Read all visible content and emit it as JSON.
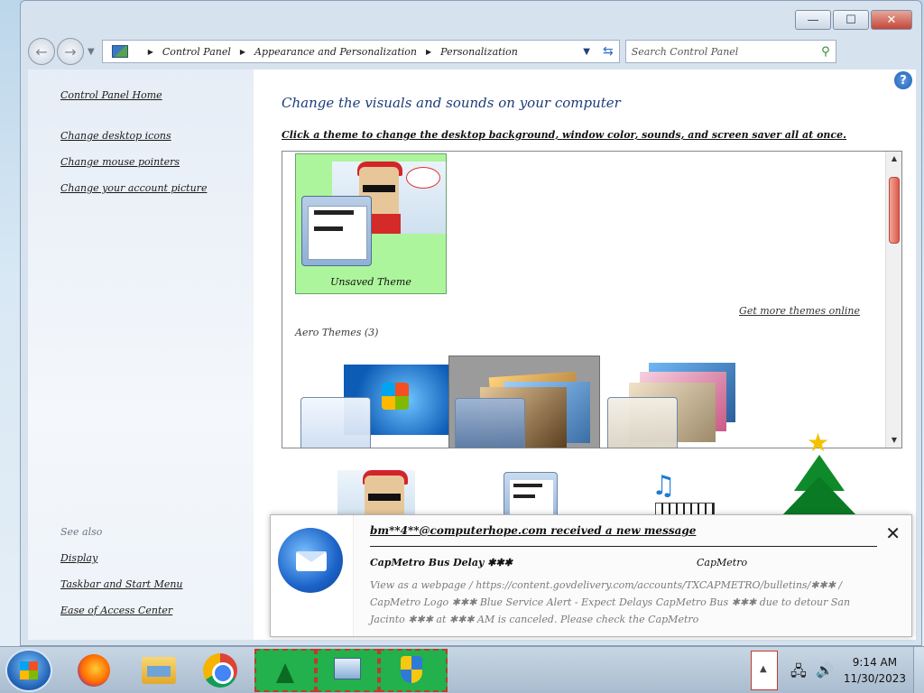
{
  "window": {
    "caption_buttons": {
      "minimize": "—",
      "maximize": "☐",
      "close": "✕"
    }
  },
  "nav": {
    "back": "←",
    "forward": "→",
    "breadcrumbs": [
      "Control Panel",
      "Appearance and Personalization",
      "Personalization"
    ],
    "search_placeholder": "Search Control Panel"
  },
  "sidebar": {
    "home": "Control Panel Home",
    "links": [
      "Change desktop icons",
      "Change mouse pointers",
      "Change your account picture"
    ],
    "see_also_header": "See also",
    "see_also": [
      "Display",
      "Taskbar and Start Menu",
      "Ease of Access Center"
    ]
  },
  "main": {
    "title": "Change the visuals and sounds on your computer",
    "subtitle": "Click a theme to change the desktop background, window color, sounds, and screen saver all at once.",
    "unsaved_theme_label": "Unsaved Theme",
    "get_more_themes": "Get more themes online",
    "aero_themes_label": "Aero Themes (3)"
  },
  "toast": {
    "title": "bm**4**@computerhope.com received a new message",
    "subject": "CapMetro Bus Delay ✱✱✱",
    "sender": "CapMetro",
    "body": "View as a webpage / https://content.govdelivery.com/accounts/TXCAPMETRO/bulletins/✱✱✱ / CapMetro Logo ✱✱✱ Blue Service Alert - Expect Delays CapMetro Bus ✱✱✱ due to detour San Jacinto ✱✱✱ at ✱✱✱ AM is canceled. Please check the CapMetro",
    "close": "✕"
  },
  "taskbar": {
    "time": "9:14 AM",
    "date": "11/30/2023",
    "tray_arrow": "▲"
  },
  "colors": {
    "selected_theme_bg": "#adf59c",
    "title_blue": "#1c3c77"
  }
}
